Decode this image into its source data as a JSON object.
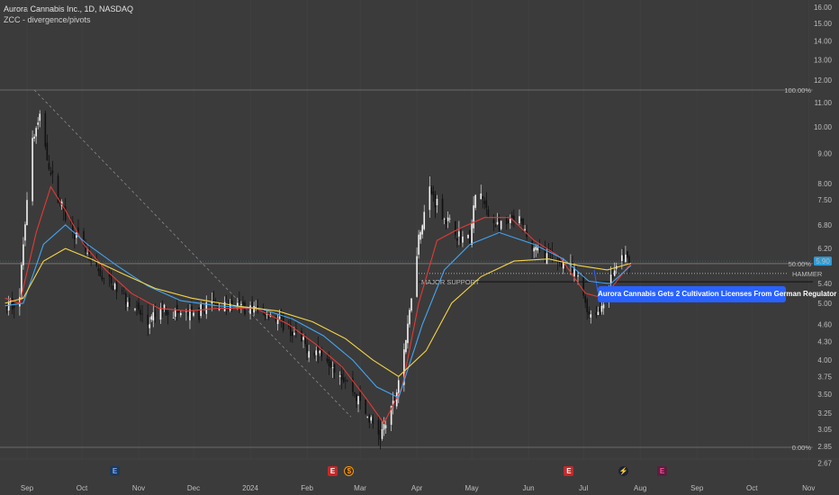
{
  "header": {
    "title": "Aurora Cannabis Inc., 1D, NASDAQ",
    "indicator": "ZCC - divergence/pivots"
  },
  "news_label": "Aurora Cannabis Gets 2 Cultivation Licenses From German Regulator",
  "price_tag": "5.90",
  "level_labels": {
    "fib_100": "100.00%",
    "fib_50": "50.00%",
    "fib_0": "0.00%",
    "support": "MAJOR SUPPORT",
    "resistance": "HAMMER"
  },
  "badges": [
    {
      "name": "earnings-badge-sep",
      "symbol": "E",
      "kind": "b-eb",
      "date": "2023-10-19"
    },
    {
      "name": "earnings-badge-feb",
      "symbol": "E",
      "kind": "b-e",
      "date": "2024-02-15"
    },
    {
      "name": "dividend-badge-feb",
      "symbol": "$",
      "kind": "b-d",
      "date": "2024-02-24"
    },
    {
      "name": "earnings-badge-jun",
      "symbol": "E",
      "kind": "b-e",
      "date": "2024-06-23"
    },
    {
      "name": "lightning-badge-jul",
      "symbol": "⚡",
      "kind": "b-lt",
      "date": "2024-07-23"
    },
    {
      "name": "earnings-badge-aug",
      "symbol": "E",
      "kind": "b-mag",
      "date": "2024-08-13"
    }
  ],
  "colors": {
    "background": "#3b3b3b",
    "up": "#f2f2f2",
    "down": "#111111",
    "ma_fast": "#e53935",
    "ma_mid": "#42a5f5",
    "ma_slow": "#f5d547",
    "news": "#2962ff"
  },
  "chart_data": {
    "type": "candlestick",
    "x_axis_labels": [
      "Sep",
      "Oct",
      "Nov",
      "Dec",
      "2024",
      "Feb",
      "Mar",
      "Apr",
      "May",
      "Jun",
      "Jul",
      "Aug",
      "Sep",
      "Oct",
      "Nov"
    ],
    "x_axis_dates": [
      "2023-09-01",
      "2023-10-01",
      "2023-11-01",
      "2023-12-01",
      "2024-01-01",
      "2024-02-01",
      "2024-03-01",
      "2024-04-01",
      "2024-05-01",
      "2024-06-01",
      "2024-07-01",
      "2024-08-01",
      "2024-09-01",
      "2024-10-01",
      "2024-11-01"
    ],
    "y_axis_labels": [
      "16.00",
      "15.00",
      "14.00",
      "13.00",
      "12.00",
      "11.00",
      "10.00",
      "9.00",
      "8.00",
      "7.50",
      "6.80",
      "6.20",
      "5.90",
      "5.40",
      "5.00",
      "4.60",
      "4.30",
      "4.00",
      "3.75",
      "3.50",
      "3.25",
      "3.05",
      "2.85",
      "2.67"
    ],
    "y_axis_values": [
      16.0,
      15.0,
      14.0,
      13.0,
      12.0,
      11.0,
      10.0,
      9.0,
      8.0,
      7.5,
      6.8,
      6.2,
      5.9,
      5.4,
      5.0,
      4.6,
      4.3,
      4.0,
      3.75,
      3.5,
      3.25,
      3.05,
      2.85,
      2.67
    ],
    "y_scale": "log",
    "levels": [
      {
        "label": "100.00%",
        "value": 11.55,
        "style": "solid"
      },
      {
        "label": "50.00%",
        "value": 5.84,
        "style": "solid"
      },
      {
        "label": "0.00%",
        "value": 2.84,
        "style": "solid"
      },
      {
        "label": "HAMMER",
        "value": 5.62,
        "style": "dotted"
      },
      {
        "label": "MAJOR SUPPORT",
        "value": 5.44,
        "style": "solid"
      }
    ],
    "last_price": 5.9,
    "diagonal_line": {
      "from": [
        "2023-09-05",
        11.55
      ],
      "to": [
        "2024-02-25",
        3.2
      ]
    },
    "price_path": [
      [
        "2023-08-20",
        4.9
      ],
      [
        "2023-08-28",
        5.1
      ],
      [
        "2023-09-04",
        9.5
      ],
      [
        "2023-09-08",
        10.3
      ],
      [
        "2023-09-14",
        8.3
      ],
      [
        "2023-09-20",
        7.3
      ],
      [
        "2023-09-28",
        6.5
      ],
      [
        "2023-10-08",
        5.7
      ],
      [
        "2023-10-18",
        5.35
      ],
      [
        "2023-10-28",
        5.0
      ],
      [
        "2023-11-06",
        4.6
      ],
      [
        "2023-11-14",
        4.9
      ],
      [
        "2023-11-22",
        4.8
      ],
      [
        "2023-12-02",
        4.75
      ],
      [
        "2023-12-10",
        5.0
      ],
      [
        "2023-12-20",
        4.95
      ],
      [
        "2024-01-02",
        4.9
      ],
      [
        "2024-01-12",
        4.8
      ],
      [
        "2024-01-22",
        4.5
      ],
      [
        "2024-02-01",
        4.2
      ],
      [
        "2024-02-10",
        4.1
      ],
      [
        "2024-02-18",
        3.85
      ],
      [
        "2024-02-26",
        3.55
      ],
      [
        "2024-03-05",
        3.2
      ],
      [
        "2024-03-12",
        2.97
      ],
      [
        "2024-03-20",
        3.4
      ],
      [
        "2024-03-27",
        4.5
      ],
      [
        "2024-04-02",
        6.5
      ],
      [
        "2024-04-08",
        7.8
      ],
      [
        "2024-04-16",
        7.0
      ],
      [
        "2024-04-24",
        6.5
      ],
      [
        "2024-04-30",
        6.4
      ],
      [
        "2024-05-04",
        8.0
      ],
      [
        "2024-05-10",
        7.0
      ],
      [
        "2024-05-18",
        6.7
      ],
      [
        "2024-05-26",
        7.0
      ],
      [
        "2024-06-03",
        6.2
      ],
      [
        "2024-06-12",
        6.0
      ],
      [
        "2024-06-20",
        5.85
      ],
      [
        "2024-06-28",
        5.5
      ],
      [
        "2024-07-04",
        4.8
      ],
      [
        "2024-07-10",
        4.85
      ],
      [
        "2024-07-16",
        5.5
      ],
      [
        "2024-07-22",
        6.0
      ],
      [
        "2024-07-27",
        5.9
      ]
    ],
    "moving_averages": [
      {
        "label": "fast",
        "color": "#e53935",
        "points": [
          [
            "2023-08-20",
            5.1
          ],
          [
            "2023-08-28",
            5.0
          ],
          [
            "2023-09-06",
            6.6
          ],
          [
            "2023-09-14",
            7.9
          ],
          [
            "2023-09-22",
            7.2
          ],
          [
            "2023-10-02",
            6.3
          ],
          [
            "2023-10-14",
            5.7
          ],
          [
            "2023-10-28",
            5.2
          ],
          [
            "2023-11-12",
            4.9
          ],
          [
            "2023-11-28",
            4.85
          ],
          [
            "2023-12-14",
            4.9
          ],
          [
            "2024-01-04",
            4.9
          ],
          [
            "2024-01-22",
            4.6
          ],
          [
            "2024-02-06",
            4.25
          ],
          [
            "2024-02-20",
            3.9
          ],
          [
            "2024-03-04",
            3.45
          ],
          [
            "2024-03-14",
            3.12
          ],
          [
            "2024-03-24",
            3.6
          ],
          [
            "2024-04-02",
            5.0
          ],
          [
            "2024-04-12",
            6.4
          ],
          [
            "2024-04-24",
            6.7
          ],
          [
            "2024-05-08",
            7.0
          ],
          [
            "2024-05-22",
            7.0
          ],
          [
            "2024-06-04",
            6.4
          ],
          [
            "2024-06-18",
            6.0
          ],
          [
            "2024-07-02",
            5.2
          ],
          [
            "2024-07-12",
            5.1
          ],
          [
            "2024-07-22",
            5.6
          ],
          [
            "2024-07-27",
            5.85
          ]
        ]
      },
      {
        "label": "mid",
        "color": "#42a5f5",
        "points": [
          [
            "2023-08-20",
            4.95
          ],
          [
            "2023-08-30",
            5.0
          ],
          [
            "2023-09-10",
            6.3
          ],
          [
            "2023-09-22",
            6.8
          ],
          [
            "2023-10-04",
            6.3
          ],
          [
            "2023-10-20",
            5.8
          ],
          [
            "2023-11-06",
            5.35
          ],
          [
            "2023-11-24",
            5.05
          ],
          [
            "2023-12-14",
            4.95
          ],
          [
            "2024-01-06",
            4.9
          ],
          [
            "2024-01-24",
            4.7
          ],
          [
            "2024-02-10",
            4.4
          ],
          [
            "2024-02-26",
            4.0
          ],
          [
            "2024-03-10",
            3.6
          ],
          [
            "2024-03-22",
            3.45
          ],
          [
            "2024-04-04",
            4.6
          ],
          [
            "2024-04-16",
            5.7
          ],
          [
            "2024-04-30",
            6.3
          ],
          [
            "2024-05-16",
            6.6
          ],
          [
            "2024-06-04",
            6.3
          ],
          [
            "2024-06-20",
            5.95
          ],
          [
            "2024-07-04",
            5.45
          ],
          [
            "2024-07-16",
            5.4
          ],
          [
            "2024-07-27",
            5.8
          ]
        ]
      },
      {
        "label": "slow",
        "color": "#f5d547",
        "points": [
          [
            "2023-08-20",
            5.0
          ],
          [
            "2023-08-30",
            5.1
          ],
          [
            "2023-09-10",
            5.9
          ],
          [
            "2023-09-22",
            6.2
          ],
          [
            "2023-10-06",
            5.95
          ],
          [
            "2023-10-24",
            5.6
          ],
          [
            "2023-11-10",
            5.3
          ],
          [
            "2023-11-30",
            5.1
          ],
          [
            "2023-12-24",
            4.95
          ],
          [
            "2024-01-16",
            4.85
          ],
          [
            "2024-02-04",
            4.65
          ],
          [
            "2024-02-22",
            4.35
          ],
          [
            "2024-03-08",
            4.0
          ],
          [
            "2024-03-22",
            3.75
          ],
          [
            "2024-04-06",
            4.15
          ],
          [
            "2024-04-20",
            5.0
          ],
          [
            "2024-05-06",
            5.55
          ],
          [
            "2024-05-24",
            5.9
          ],
          [
            "2024-06-12",
            5.95
          ],
          [
            "2024-06-28",
            5.8
          ],
          [
            "2024-07-14",
            5.7
          ],
          [
            "2024-07-27",
            5.85
          ]
        ]
      }
    ]
  }
}
